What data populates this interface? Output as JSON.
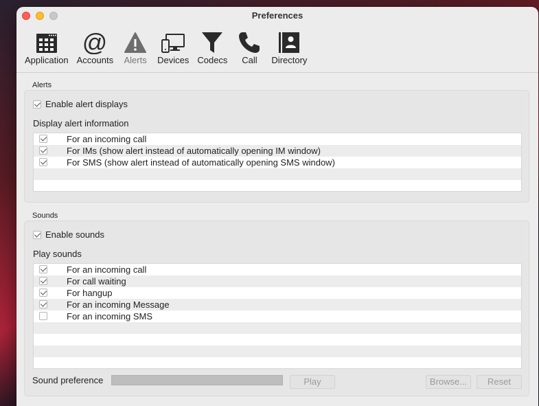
{
  "window": {
    "title": "Preferences"
  },
  "toolbar": {
    "items": [
      {
        "label": "Application",
        "icon": "grid-calendar-icon"
      },
      {
        "label": "Accounts",
        "icon": "at-sign-icon"
      },
      {
        "label": "Alerts",
        "icon": "warning-triangle-icon"
      },
      {
        "label": "Devices",
        "icon": "monitor-devices-icon"
      },
      {
        "label": "Codecs",
        "icon": "funnel-icon"
      },
      {
        "label": "Call",
        "icon": "phone-icon"
      },
      {
        "label": "Directory",
        "icon": "contact-book-icon"
      }
    ],
    "active": "Alerts"
  },
  "alerts": {
    "section_label": "Alerts",
    "enable_label": "Enable alert displays",
    "enable_checked": true,
    "info_label": "Display alert information",
    "items": [
      {
        "label": "For an incoming call",
        "checked": true
      },
      {
        "label": "For IMs (show alert instead of automatically opening IM window)",
        "checked": true
      },
      {
        "label": "For SMS (show alert instead of automatically opening SMS window)",
        "checked": true
      }
    ]
  },
  "sounds": {
    "section_label": "Sounds",
    "enable_label": "Enable sounds",
    "enable_checked": true,
    "play_label": "Play sounds",
    "items": [
      {
        "label": "For an incoming call",
        "checked": true
      },
      {
        "label": "For call waiting",
        "checked": true
      },
      {
        "label": "For hangup",
        "checked": true
      },
      {
        "label": "For an incoming Message",
        "checked": true
      },
      {
        "label": "For an incoming SMS",
        "checked": false
      }
    ],
    "preference_label": "Sound preference",
    "play_button": "Play",
    "browse_button": "Browse...",
    "reset_button": "Reset"
  }
}
